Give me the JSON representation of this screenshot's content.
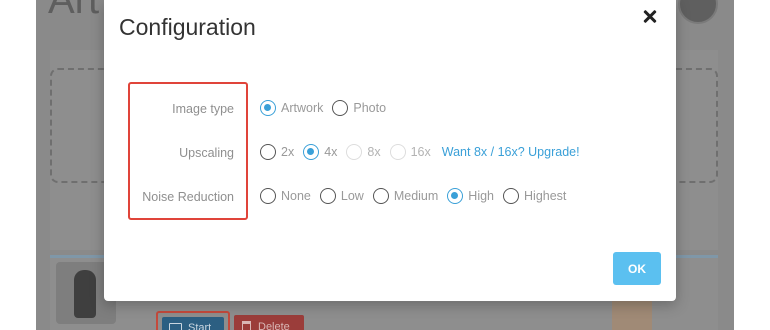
{
  "background": {
    "page_title": "Art",
    "start_label": "Start",
    "delete_label": "Delete"
  },
  "modal": {
    "title": "Configuration",
    "ok_label": "OK",
    "image_type": {
      "label": "Image type",
      "options": [
        {
          "label": "Artwork",
          "checked": true
        },
        {
          "label": "Photo",
          "checked": false
        }
      ]
    },
    "upscaling": {
      "label": "Upscaling",
      "options": [
        {
          "label": "2x",
          "checked": false,
          "disabled": false
        },
        {
          "label": "4x",
          "checked": true,
          "disabled": false
        },
        {
          "label": "8x",
          "checked": false,
          "disabled": true
        },
        {
          "label": "16x",
          "checked": false,
          "disabled": true
        }
      ],
      "upgrade_link": "Want 8x / 16x? Upgrade!"
    },
    "noise_reduction": {
      "label": "Noise Reduction",
      "options": [
        {
          "label": "None",
          "checked": false
        },
        {
          "label": "Low",
          "checked": false
        },
        {
          "label": "Medium",
          "checked": false
        },
        {
          "label": "High",
          "checked": true
        },
        {
          "label": "Highest",
          "checked": false
        }
      ]
    }
  },
  "colors": {
    "accent": "#3aa0d8",
    "ok_button": "#5bc0f0",
    "highlight_box": "#e0443a",
    "delete_button": "#9b3d3a",
    "start_button": "#2c5f82"
  }
}
